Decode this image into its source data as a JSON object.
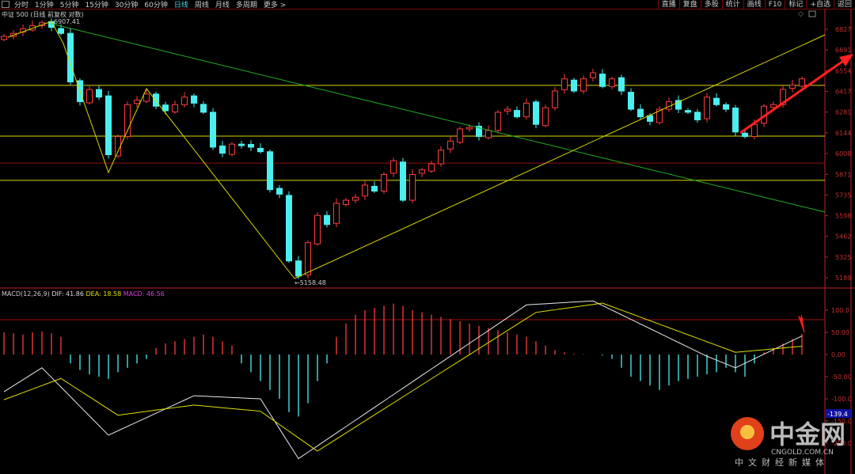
{
  "toolbar": {
    "periods": [
      "分时",
      "1分钟",
      "5分钟",
      "15分钟",
      "30分钟",
      "60分钟",
      "日线",
      "周线",
      "月线",
      "多周期",
      "更多 >"
    ],
    "active": "日线",
    "right_buttons": [
      "直播",
      "复盘",
      "多股",
      "统计",
      "画线",
      "F10",
      "标记",
      "+自选",
      "返回"
    ]
  },
  "chart_title": "中证 500 (日线 前复权 对数)",
  "macd_label": {
    "name": "MACD(12,26,9)",
    "dif": "DIF: 41.86",
    "dea": "DEA: 18.58",
    "macd": "MACD: 46.56"
  },
  "annotations": {
    "high": "6907.41",
    "low": "←5158.48",
    "cursor_value": "-139.4"
  },
  "colors": {
    "up": "#ff3b3b",
    "down": "#4af0f0",
    "dif": "#e8e8e8",
    "dea": "#e0e000",
    "axis": "#c02020",
    "hline": "#d8d800"
  },
  "logo": {
    "name": "中金网",
    "url": "CNGOLD.COM.CN",
    "slogan": "中文财经新媒体"
  },
  "chart_data": [
    {
      "type": "candlestick",
      "title": "中证 500 日线",
      "y_ticks": [
        6827,
        6691,
        6554,
        6417,
        6281,
        6144,
        6008,
        5871,
        5735,
        5598,
        5462,
        5325,
        5189
      ],
      "closes": [
        6780,
        6800,
        6830,
        6850,
        6870,
        6840,
        6800,
        6480,
        6350,
        6430,
        6380,
        6000,
        6120,
        6330,
        6360,
        6400,
        6320,
        6290,
        6330,
        6380,
        6340,
        6280,
        6050,
        6010,
        6070,
        6060,
        6050,
        6020,
        5770,
        5740,
        5300,
        5200,
        5420,
        5600,
        5540,
        5680,
        5700,
        5720,
        5800,
        5760,
        5870,
        5960,
        5700,
        5870,
        5900,
        5940,
        6030,
        6090,
        6170,
        6180,
        6120,
        6160,
        6280,
        6300,
        6250,
        6340,
        6200,
        6310,
        6420,
        6500,
        6420,
        6500,
        6540,
        6450,
        6500,
        6420,
        6300,
        6250,
        6220,
        6300,
        6350,
        6300,
        6280,
        6230,
        6380,
        6330,
        6300,
        6150,
        6120,
        6200,
        6320,
        6330,
        6430,
        6460,
        6500
      ],
      "horizontal_levels": [
        6457,
        6123,
        5945,
        5831
      ]
    },
    {
      "type": "bar+line",
      "title": "MACD(12,26,9)",
      "y_ticks": [
        "100.0",
        "50.00",
        "0.00",
        "-50.00",
        "-100.0",
        "-150.0",
        "-200.0"
      ],
      "histogram": [
        50,
        48,
        45,
        50,
        52,
        48,
        40,
        -20,
        -35,
        -45,
        -50,
        -55,
        -40,
        -30,
        -20,
        -10,
        15,
        25,
        30,
        35,
        40,
        45,
        40,
        30,
        20,
        -20,
        -40,
        -60,
        -80,
        -100,
        -130,
        -140,
        -110,
        -60,
        -20,
        40,
        70,
        90,
        100,
        105,
        110,
        115,
        110,
        100,
        95,
        90,
        85,
        80,
        75,
        70,
        65,
        60,
        55,
        50,
        45,
        40,
        30,
        20,
        10,
        5,
        2,
        1,
        0,
        -2,
        -10,
        -30,
        -50,
        -60,
        -70,
        -80,
        -70,
        -60,
        -55,
        -50,
        -45,
        -40,
        -30,
        -40,
        -50,
        -20,
        5,
        15,
        25,
        35,
        46.56
      ],
      "dif": [
        [
          0,
          -84
        ],
        [
          4,
          -30
        ],
        [
          11,
          -182
        ],
        [
          20,
          -93
        ],
        [
          27,
          -100
        ],
        [
          31,
          -235
        ],
        [
          55,
          112
        ],
        [
          62,
          121
        ],
        [
          74,
          -4
        ],
        [
          77,
          -30
        ],
        [
          84,
          41.86
        ]
      ],
      "dea": [
        [
          0,
          -102
        ],
        [
          6,
          -54
        ],
        [
          12,
          -137
        ],
        [
          20,
          -114
        ],
        [
          27,
          -128
        ],
        [
          33,
          -218
        ],
        [
          56,
          95
        ],
        [
          63,
          116
        ],
        [
          77,
          5
        ],
        [
          84,
          18.58
        ]
      ]
    }
  ]
}
